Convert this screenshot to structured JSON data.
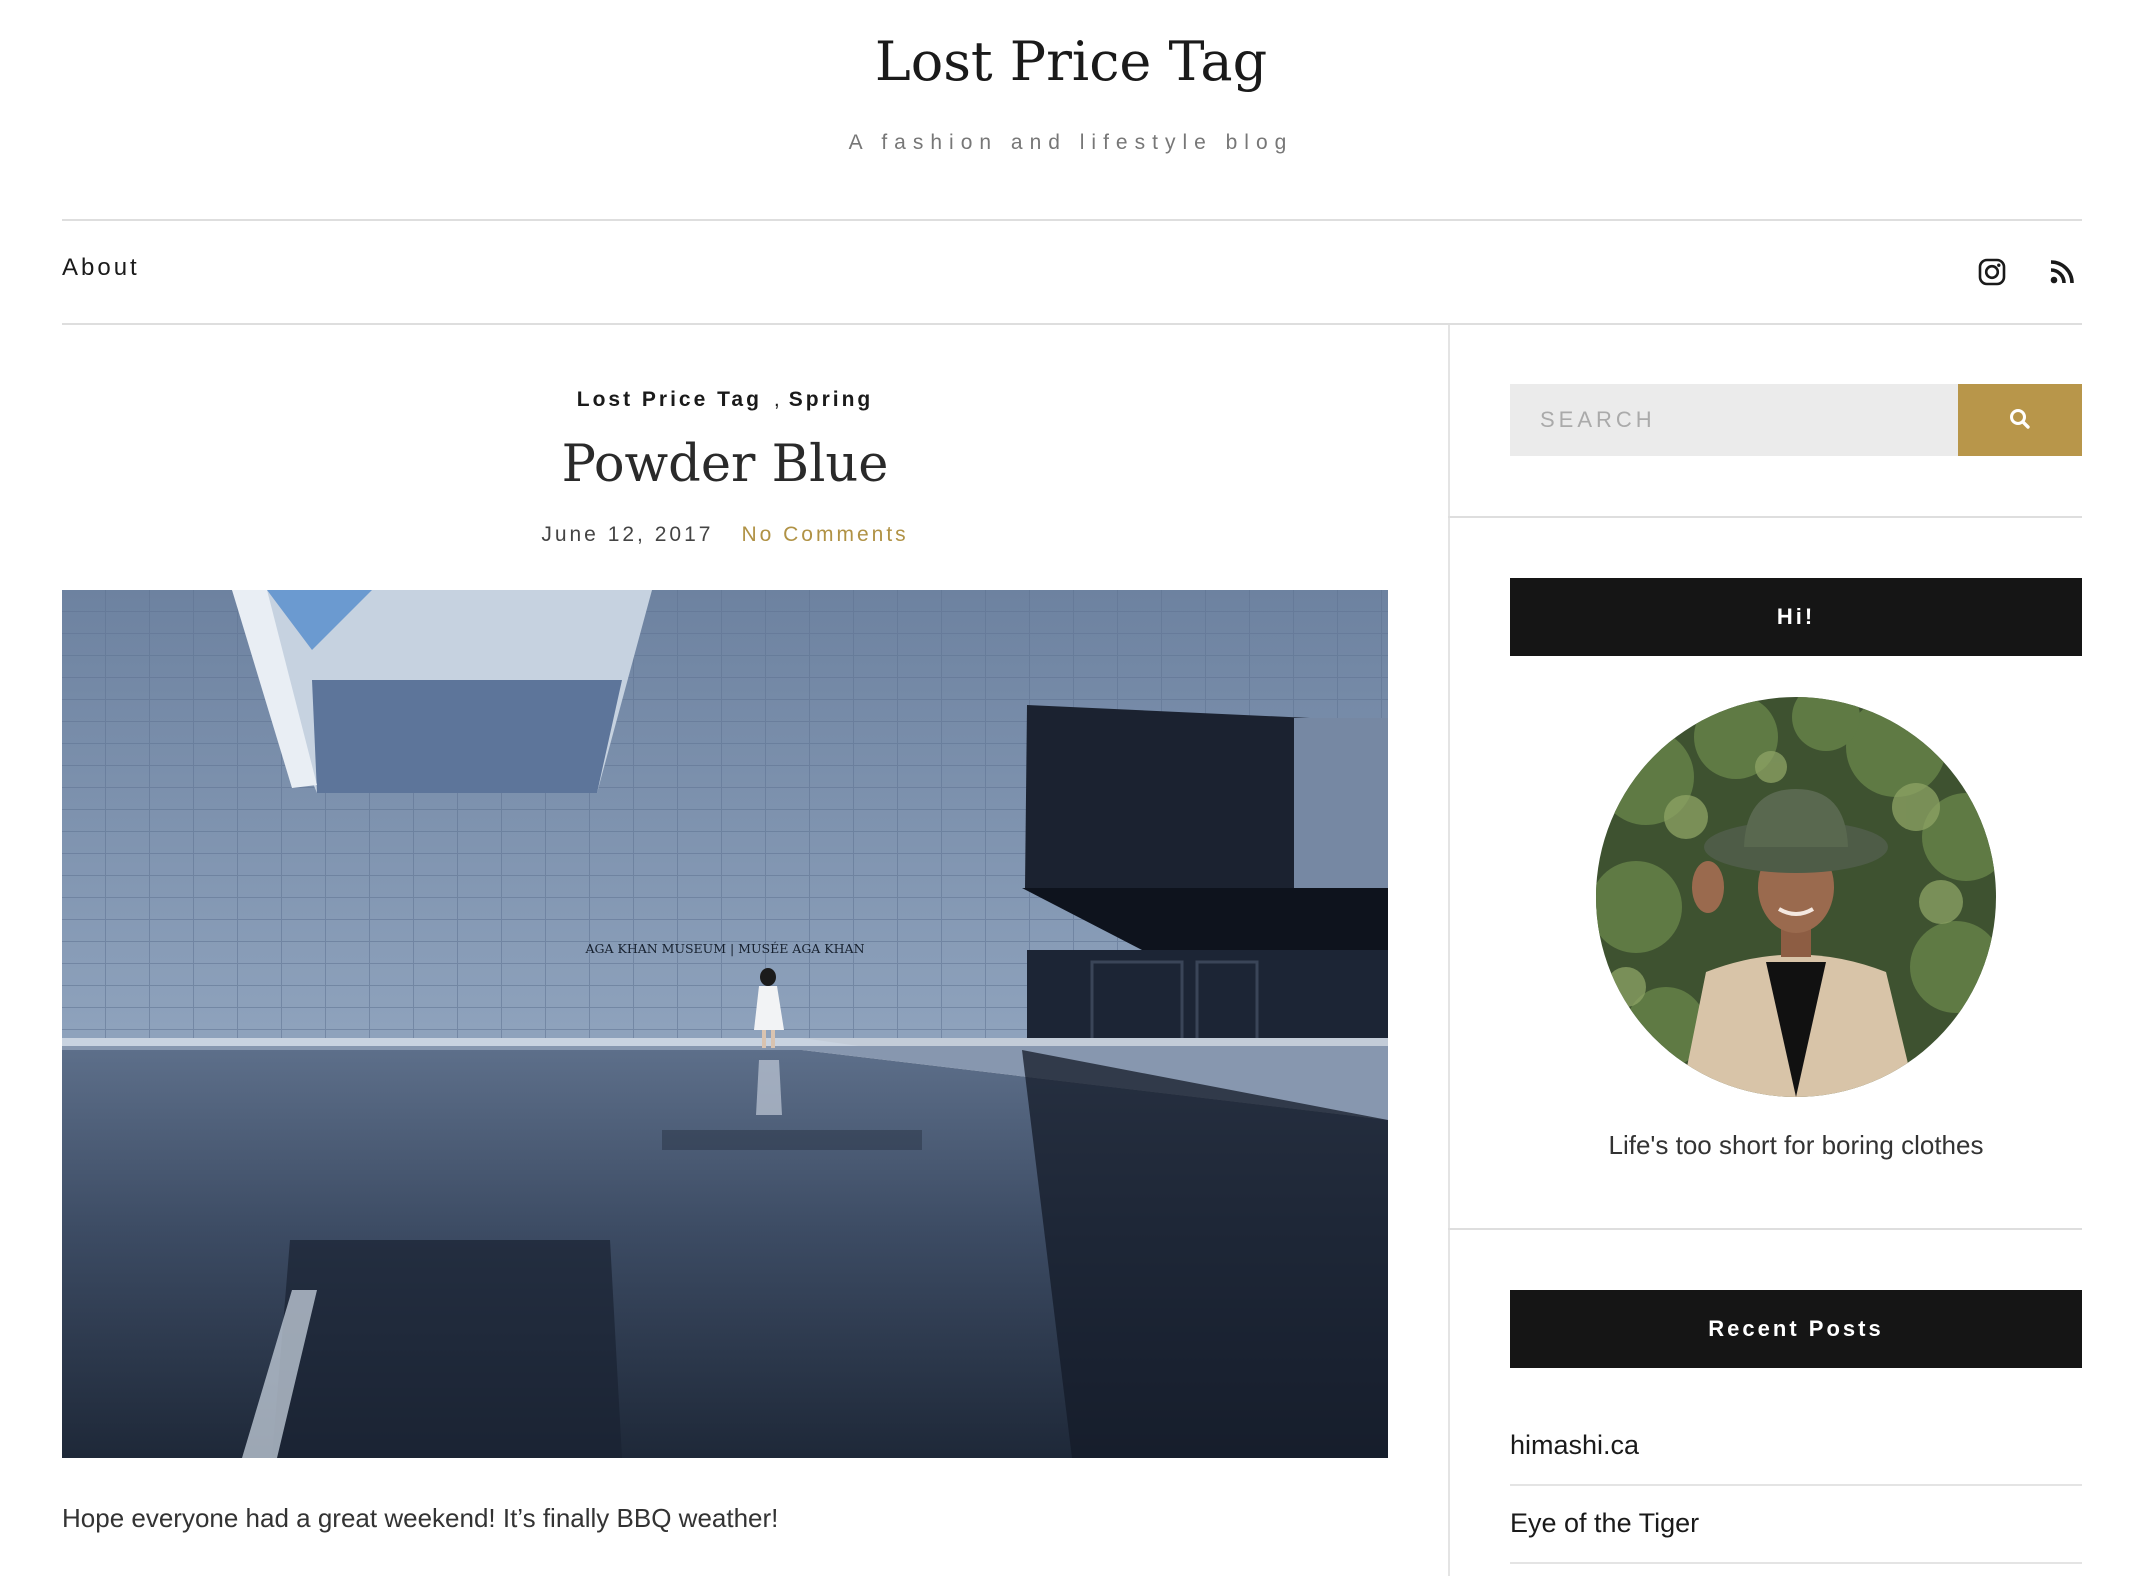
{
  "site": {
    "title": "Lost Price Tag",
    "tagline": "A fashion and lifestyle blog"
  },
  "nav": {
    "about": "About",
    "icons": [
      "instagram-icon",
      "rss-icon"
    ]
  },
  "post": {
    "categories": [
      "Lost Price Tag",
      "Spring"
    ],
    "category_separator": ",",
    "title": "Powder Blue",
    "date": "June 12, 2017",
    "comments": "No Comments",
    "image_sign": "AGA KHAN MUSEUM | MUSÉE AGA KHAN",
    "excerpt": "Hope everyone had a great weekend! It’s finally BBQ weather!"
  },
  "sidebar": {
    "search_placeholder": "SEARCH",
    "about_widget_title": "Hi!",
    "about_text": "Life's too short for boring clothes",
    "recent_title": "Recent Posts",
    "recent_posts": [
      "himashi.ca",
      "Eye of the Tiger"
    ]
  },
  "colors": {
    "accent": "#b8964a",
    "widget_bar": "#151515",
    "divider": "#dedede"
  }
}
